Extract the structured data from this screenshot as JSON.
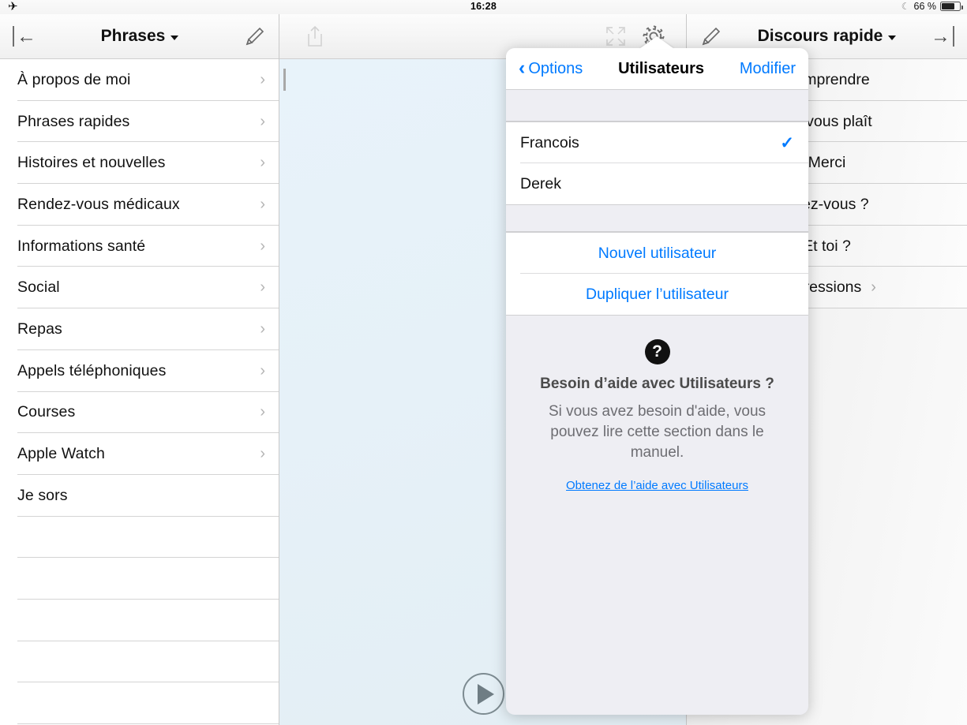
{
  "status_bar": {
    "airplane_icon": "airplane-mode-icon",
    "time": "16:28",
    "dnd_icon": "moon-do-not-disturb-icon",
    "battery_percent": "66 %",
    "battery_level": 66
  },
  "left_panel": {
    "header": {
      "back_icon": "back-to-start-arrow-icon",
      "title": "Phrases",
      "dropdown_icon": "caret-down-icon",
      "edit_icon": "pencil-edit-icon"
    },
    "items": [
      {
        "label": "À propos de moi",
        "chevron": true
      },
      {
        "label": "Phrases rapides",
        "chevron": true
      },
      {
        "label": "Histoires et nouvelles",
        "chevron": true
      },
      {
        "label": "Rendez-vous médicaux",
        "chevron": true
      },
      {
        "label": "Informations santé",
        "chevron": true
      },
      {
        "label": "Social",
        "chevron": true
      },
      {
        "label": "Repas",
        "chevron": true
      },
      {
        "label": "Appels téléphoniques",
        "chevron": true
      },
      {
        "label": "Courses",
        "chevron": true
      },
      {
        "label": "Apple Watch",
        "chevron": true
      },
      {
        "label": "Je sors",
        "chevron": false
      },
      {
        "label": "",
        "chevron": false
      },
      {
        "label": "",
        "chevron": false
      },
      {
        "label": "",
        "chevron": false
      },
      {
        "label": "",
        "chevron": false
      },
      {
        "label": "",
        "chevron": false
      }
    ]
  },
  "center_panel": {
    "toolbar": {
      "share_icon": "share-upload-icon",
      "expand_icon": "expand-fullscreen-icon",
      "settings_icon": "gear-settings-icon"
    },
    "text_value": "",
    "play_icon": "play-speak-icon"
  },
  "right_panel": {
    "header": {
      "edit_icon": "pencil-edit-icon",
      "title": "Discours rapide",
      "dropdown_icon": "caret-down-icon",
      "forward_icon": "forward-to-end-arrow-icon"
    },
    "items": [
      {
        "label": "Comprendre",
        "chevron": false
      },
      {
        "label": "S'il vous plaît",
        "chevron": false
      },
      {
        "label": "Merci",
        "chevron": false
      },
      {
        "label": "Allez-vous ?",
        "chevron": false
      },
      {
        "label": "Et toi ?",
        "chevron": false
      },
      {
        "label": "Expressions",
        "chevron": true
      }
    ]
  },
  "popover": {
    "back_label": "Options",
    "back_icon": "chevron-left-icon",
    "title": "Utilisateurs",
    "edit_label": "Modifier",
    "users": [
      {
        "name": "Francois",
        "selected": true
      },
      {
        "name": "Derek",
        "selected": false
      }
    ],
    "check_icon": "checkmark-icon",
    "actions": [
      {
        "label": "Nouvel utilisateur"
      },
      {
        "label": "Dupliquer l’utilisateur"
      }
    ],
    "help": {
      "icon": "question-mark-icon",
      "icon_glyph": "?",
      "heading": "Besoin d’aide avec Utilisateurs ?",
      "body": "Si vous avez besoin d'aide, vous pouvez lire cette section dans le manuel.",
      "link": "Obtenez de l’aide avec Utilisateurs"
    }
  },
  "colors": {
    "accent": "#007aff",
    "canvas": "#e6f1f8",
    "separator": "#d4d4d4",
    "popover_bg": "#eeeef3"
  }
}
